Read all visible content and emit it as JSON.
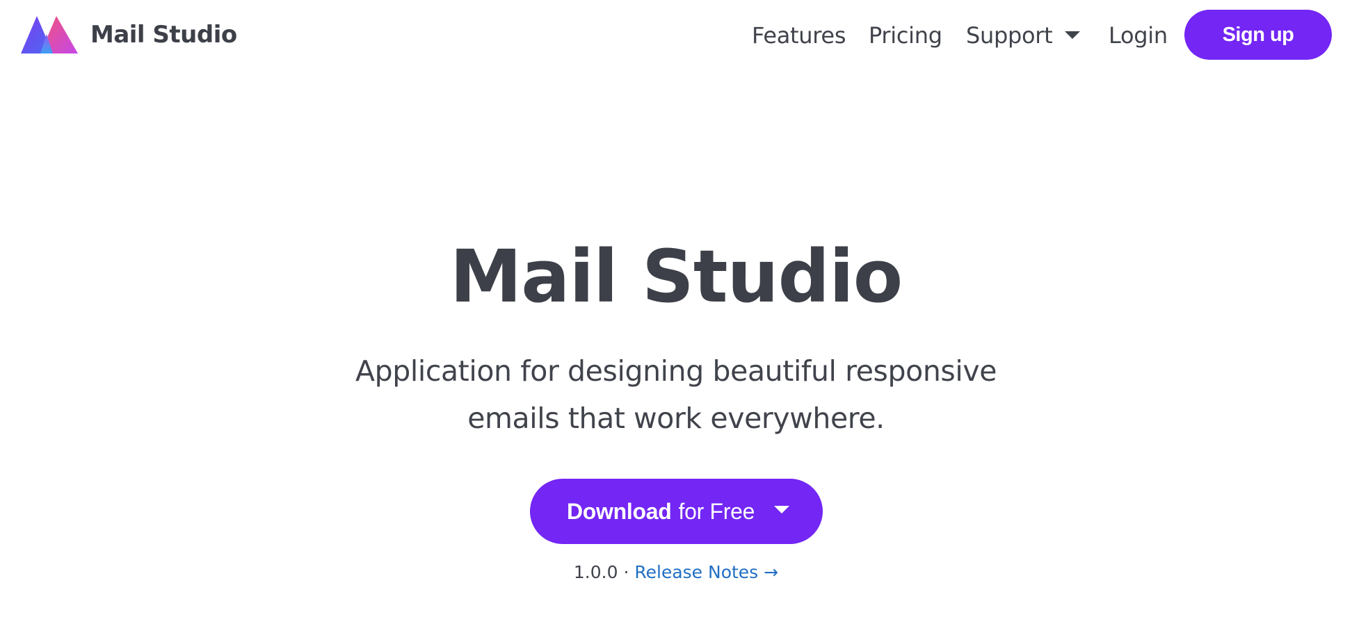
{
  "navbar": {
    "brand_name": "Mail Studio",
    "links": {
      "features": "Features",
      "pricing": "Pricing",
      "support": "Support",
      "login": "Login"
    },
    "signup_label": "Sign up"
  },
  "hero": {
    "title": "Mail Studio",
    "subtitle_line1": "Application for designing beautiful responsive",
    "subtitle_line2": "emails that work everywhere.",
    "download_strong": "Download",
    "download_rest": "for Free",
    "version": "1.0.0",
    "separator": "·",
    "release_notes": "Release Notes →"
  },
  "colors": {
    "accent": "#7326f4",
    "text": "#3d4048",
    "link": "#1f6fc4"
  },
  "icons": {
    "logo": "triangles-logo-icon",
    "dropdown": "caret-down-icon"
  }
}
